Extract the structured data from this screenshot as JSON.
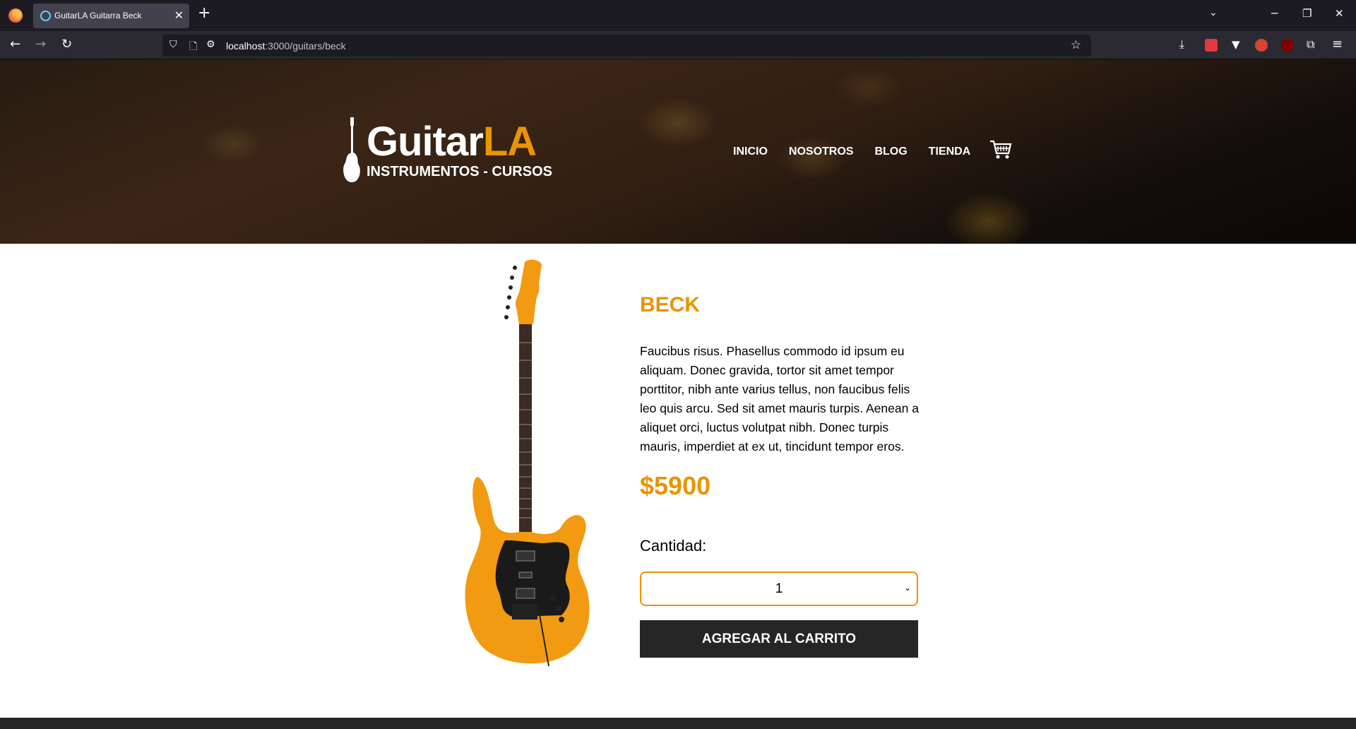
{
  "browser": {
    "tab_title": "GuitarLA Guitarra Beck",
    "url_host": "localhost",
    "url_path": ":3000/guitars/beck"
  },
  "header": {
    "logo_word_main": "Guitar",
    "logo_word_accent": "LA",
    "logo_subtitle": "INSTRUMENTOS - CURSOS",
    "nav": [
      "INICIO",
      "NOSOTROS",
      "BLOG",
      "TIENDA"
    ]
  },
  "product": {
    "name": "BECK",
    "description": "Faucibus risus. Phasellus commodo id ipsum eu aliquam. Donec gravida, tortor sit amet tempor porttitor, nibh ante varius tellus, non faucibus felis leo quis arcu. Sed sit amet mauris turpis. Aenean a aliquet orci, luctus volutpat nibh. Donec turpis mauris, imperdiet at ex ut, tincidunt tempor eros.",
    "price": "$5900",
    "quantity_label": "Cantidad:",
    "quantity_value": "1",
    "add_button": "AGREGAR AL CARRITO"
  },
  "colors": {
    "accent": "#e99401",
    "dark": "#262626"
  }
}
